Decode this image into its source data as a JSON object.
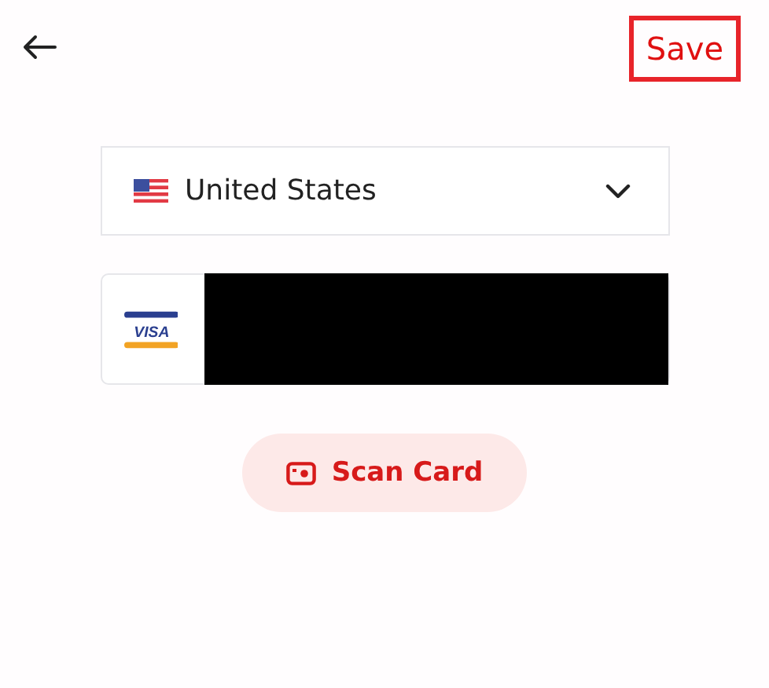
{
  "header": {
    "save_label": "Save",
    "save_highlighted": true
  },
  "country_select": {
    "value": "United States"
  },
  "card_field": {
    "brand": "VISA",
    "redacted": true
  },
  "scan_button": {
    "label": "Scan Card"
  }
}
